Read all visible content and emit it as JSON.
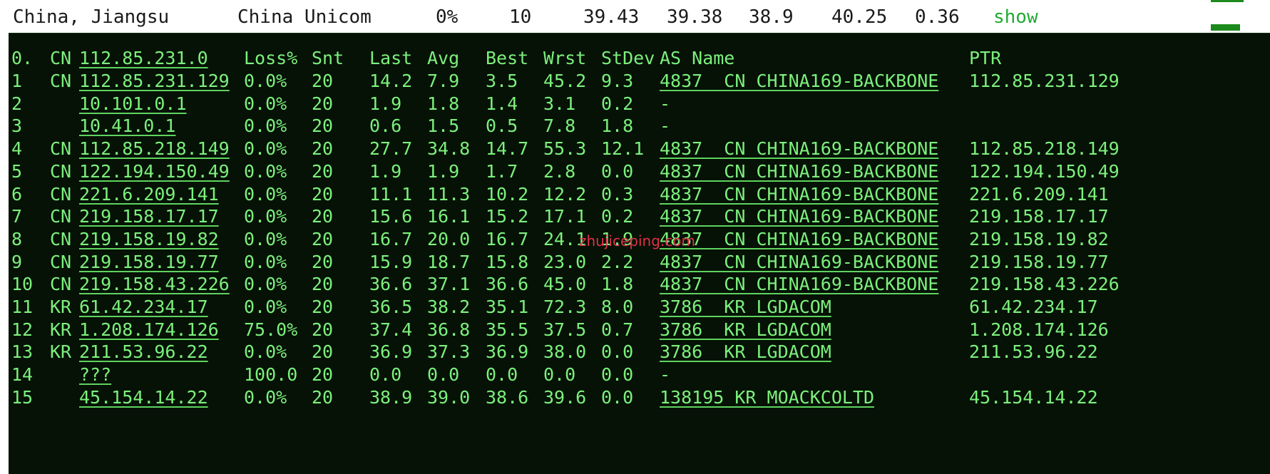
{
  "summary": {
    "location": "China, Jiangsu",
    "isp": "China Unicom",
    "loss": "0%",
    "sent": "10",
    "last": "39.43",
    "avg": "39.38",
    "best": "38.9",
    "worst": "40.25",
    "stdev": "0.36",
    "action": "show"
  },
  "header": {
    "index": "0.",
    "cc": "CN",
    "host": "112.85.231.0",
    "loss": "Loss%",
    "snt": "Snt",
    "last": "Last",
    "avg": "Avg",
    "best": "Best",
    "wrst": "Wrst",
    "stdev": "StDev",
    "asname": "AS Name",
    "ptr": "PTR"
  },
  "hops": [
    {
      "n": "1",
      "cc": "CN",
      "host": "112.85.231.129",
      "loss": "0.0%",
      "snt": "20",
      "last": "14.2",
      "avg": "7.9",
      "best": "3.5",
      "wrst": "45.2",
      "stdev": "9.3",
      "as": "4837  CN CHINA169-BACKBONE",
      "as_link": true,
      "ptr": "112.85.231.129"
    },
    {
      "n": "2",
      "cc": "",
      "host": "10.101.0.1",
      "loss": "0.0%",
      "snt": "20",
      "last": "1.9",
      "avg": "1.8",
      "best": "1.4",
      "wrst": "3.1",
      "stdev": "0.2",
      "as": "-",
      "as_link": false,
      "ptr": ""
    },
    {
      "n": "3",
      "cc": "",
      "host": "10.41.0.1",
      "loss": "0.0%",
      "snt": "20",
      "last": "0.6",
      "avg": "1.5",
      "best": "0.5",
      "wrst": "7.8",
      "stdev": "1.8",
      "as": "-",
      "as_link": false,
      "ptr": ""
    },
    {
      "n": "4",
      "cc": "CN",
      "host": "112.85.218.149",
      "loss": "0.0%",
      "snt": "20",
      "last": "27.7",
      "avg": "34.8",
      "best": "14.7",
      "wrst": "55.3",
      "stdev": "12.1",
      "as": "4837  CN CHINA169-BACKBONE",
      "as_link": true,
      "ptr": "112.85.218.149"
    },
    {
      "n": "5",
      "cc": "CN",
      "host": "122.194.150.49",
      "loss": "0.0%",
      "snt": "20",
      "last": "1.9",
      "avg": "1.9",
      "best": "1.7",
      "wrst": "2.8",
      "stdev": "0.0",
      "as": "4837  CN CHINA169-BACKBONE",
      "as_link": true,
      "ptr": "122.194.150.49"
    },
    {
      "n": "6",
      "cc": "CN",
      "host": "221.6.209.141",
      "loss": "0.0%",
      "snt": "20",
      "last": "11.1",
      "avg": "11.3",
      "best": "10.2",
      "wrst": "12.2",
      "stdev": "0.3",
      "as": "4837  CN CHINA169-BACKBONE",
      "as_link": true,
      "ptr": "221.6.209.141"
    },
    {
      "n": "7",
      "cc": "CN",
      "host": "219.158.17.17",
      "loss": "0.0%",
      "snt": "20",
      "last": "15.6",
      "avg": "16.1",
      "best": "15.2",
      "wrst": "17.1",
      "stdev": "0.2",
      "as": "4837  CN CHINA169-BACKBONE",
      "as_link": true,
      "ptr": "219.158.17.17"
    },
    {
      "n": "8",
      "cc": "CN",
      "host": "219.158.19.82",
      "loss": "0.0%",
      "snt": "20",
      "last": "16.7",
      "avg": "20.0",
      "best": "16.7",
      "wrst": "24.1",
      "stdev": "1.9",
      "as": "4837  CN CHINA169-BACKBONE",
      "as_link": true,
      "ptr": "219.158.19.82"
    },
    {
      "n": "9",
      "cc": "CN",
      "host": "219.158.19.77",
      "loss": "0.0%",
      "snt": "20",
      "last": "15.9",
      "avg": "18.7",
      "best": "15.8",
      "wrst": "23.0",
      "stdev": "2.2",
      "as": "4837  CN CHINA169-BACKBONE",
      "as_link": true,
      "ptr": "219.158.19.77"
    },
    {
      "n": "10",
      "cc": "CN",
      "host": "219.158.43.226",
      "loss": "0.0%",
      "snt": "20",
      "last": "36.6",
      "avg": "37.1",
      "best": "36.6",
      "wrst": "45.0",
      "stdev": "1.8",
      "as": "4837  CN CHINA169-BACKBONE",
      "as_link": true,
      "ptr": "219.158.43.226"
    },
    {
      "n": "11",
      "cc": "KR",
      "host": "61.42.234.17",
      "loss": "0.0%",
      "snt": "20",
      "last": "36.5",
      "avg": "38.2",
      "best": "35.1",
      "wrst": "72.3",
      "stdev": "8.0",
      "as": "3786  KR LGDACOM",
      "as_link": true,
      "ptr": "61.42.234.17"
    },
    {
      "n": "12",
      "cc": "KR",
      "host": "1.208.174.126",
      "loss": "75.0%",
      "snt": "20",
      "last": "37.4",
      "avg": "36.8",
      "best": "35.5",
      "wrst": "37.5",
      "stdev": "0.7",
      "as": "3786  KR LGDACOM",
      "as_link": true,
      "ptr": "1.208.174.126"
    },
    {
      "n": "13",
      "cc": "KR",
      "host": "211.53.96.22",
      "loss": "0.0%",
      "snt": "20",
      "last": "36.9",
      "avg": "37.3",
      "best": "36.9",
      "wrst": "38.0",
      "stdev": "0.0",
      "as": "3786  KR LGDACOM",
      "as_link": true,
      "ptr": "211.53.96.22"
    },
    {
      "n": "14",
      "cc": "",
      "host": "???",
      "loss": "100.0",
      "snt": "20",
      "last": "0.0",
      "avg": "0.0",
      "best": "0.0",
      "wrst": "0.0",
      "stdev": "0.0",
      "as": "-",
      "as_link": false,
      "ptr": ""
    },
    {
      "n": "15",
      "cc": "",
      "host": "45.154.14.22",
      "loss": "0.0%",
      "snt": "20",
      "last": "38.9",
      "avg": "39.0",
      "best": "38.6",
      "wrst": "39.6",
      "stdev": "0.0",
      "as": "138195 KR MOACKCOLTD",
      "as_link": true,
      "ptr": "45.154.14.22"
    }
  ],
  "watermark": "zhujiceping.com",
  "colors": {
    "terminal_bg": "#061206",
    "terminal_text": "#7cf07c",
    "show_link": "#22aa33",
    "watermark": "#e0304a"
  }
}
